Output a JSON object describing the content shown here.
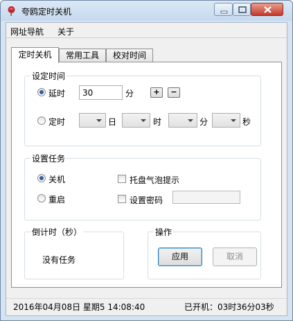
{
  "window": {
    "title": "夸鸥定时关机"
  },
  "menu": {
    "items": [
      "网址导航",
      "关于"
    ]
  },
  "tabs": {
    "items": [
      "定时关机",
      "常用工具",
      "校对时间"
    ]
  },
  "set_time": {
    "title": "设定时间",
    "delay_label": "延时",
    "delay_value": "30",
    "delay_unit": "分",
    "plus_label": "+",
    "minus_label": "−",
    "timed_label": "定时",
    "day_unit": "日",
    "hour_unit": "时",
    "minute_unit": "分",
    "second_unit": "秒"
  },
  "task": {
    "title": "设置任务",
    "shutdown_label": "关机",
    "restart_label": "重启",
    "tray_tip_label": "托盘气泡提示",
    "password_label": "设置密码"
  },
  "countdown": {
    "title": "倒计时（秒）",
    "status": "没有任务"
  },
  "actions": {
    "title": "操作",
    "apply_label": "应用",
    "cancel_label": "取消"
  },
  "status": {
    "datetime": "2016年04月08日 星期5 14:08:40",
    "uptime": "已开机：03时36分03秒"
  },
  "colors": {
    "accent": "#2b5fa8",
    "close_button": "#c4392a"
  }
}
